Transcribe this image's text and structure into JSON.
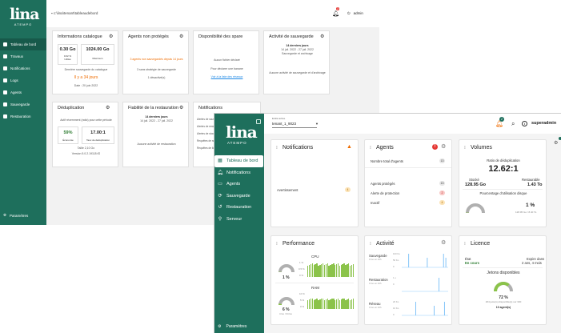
{
  "old_ui": {
    "logo_text": "lina",
    "logo_sub": "ATEMPO",
    "path": "c:\\lina\\tenant\\tableaudebord",
    "bell_badge": "2",
    "user": "admin",
    "nav": [
      {
        "label": "Tableau de bord",
        "active": true
      },
      {
        "label": "Travaux"
      },
      {
        "label": "Notifications"
      },
      {
        "label": "Logs"
      },
      {
        "label": "Agents"
      },
      {
        "label": "Sauvegarde"
      },
      {
        "label": "Restauration"
      }
    ],
    "settings": "Paramètres",
    "cards": {
      "catalog": {
        "title": "Informations catalogue",
        "used_value": "0.30 Go",
        "used_pct": "0.02 %",
        "used_label": "Utilisé",
        "max_value": "1024.00 Go",
        "max_label": "Maximum",
        "last_backup_label": "Dernière sauvegarde du catalogue",
        "last_backup_ago": "Il y a 34 jours",
        "date": "Date : 20 juin 2022"
      },
      "unprotected": {
        "title": "Agents non protégés",
        "warning": "3 agents non sauvegardés depuis 14 jours",
        "line1": "3 sans stratégie de sauvegarde",
        "line2": "1 désactivé(s)"
      },
      "spare": {
        "title": "Disponibilité des spare",
        "line1": "Aucun fichier déclaré",
        "line2": "Pour déclarer une banane",
        "link": "Voir à la liste des réseaux"
      },
      "backup": {
        "title": "Activité de sauvegarde",
        "period": "14 derniers jours",
        "range": "14 juil. 2022 - 27 juil. 2022",
        "sub": "Sauvegarde et archivage",
        "empty": "Aucune activité de sauvegarde et d'archivage"
      },
      "dedup": {
        "title": "Déduplication",
        "desc": "Actif récemment (ratio) pour cette période",
        "saving_value": "59%",
        "saving_label": "Économie",
        "ratio_value": "17.00:1",
        "ratio_label": "Taux de déduplication",
        "total": "Taille 2,10 Go",
        "version": "Version 5.0.2.19118.fG"
      },
      "restore": {
        "title": "Fiabilité de la restauration",
        "period": "14 derniers jours",
        "range": "14 juil. 2022 - 27 juil. 2022",
        "empty": "Aucune activité de restauration"
      },
      "notif": {
        "title": "Notifications",
        "items": [
          "Alertes de sauvegarde",
          "Alertes de restauration",
          "Alertes de stockage",
          "Requêtes de support",
          "Requêtes de licence"
        ]
      }
    }
  },
  "new_ui": {
    "logo_text": "lina",
    "logo_sub": "ATEMPO",
    "tenant_label": "Entité active",
    "tenant_value": "tenant_1_9023",
    "bell_badge": "2",
    "user": "superadmin",
    "nav": [
      {
        "label": "Tableau de bord",
        "icon": "dashboard-icon",
        "active": true
      },
      {
        "label": "Notifications",
        "icon": "bell-icon"
      },
      {
        "label": "Agents",
        "icon": "monitor-icon"
      },
      {
        "label": "Sauvegarde",
        "icon": "backup-icon"
      },
      {
        "label": "Restauration",
        "icon": "restore-icon"
      },
      {
        "label": "Serveur",
        "icon": "server-icon"
      }
    ],
    "settings": "Paramètres",
    "notifications": {
      "title": "Notifications",
      "warning_label": "Avertissement",
      "warning_count": "4"
    },
    "agents": {
      "title": "Agents",
      "alert_badge": "!",
      "total_label": "Nombre total d'agents",
      "total_count": "13",
      "rows": [
        {
          "label": "Agents protégés",
          "count": "13"
        },
        {
          "label": "Alerte de protection",
          "count": "2"
        },
        {
          "label": "Inactif",
          "count": "4"
        }
      ]
    },
    "volumes": {
      "title": "Volumes",
      "ratio_label": "Ratio de déduplication",
      "ratio_value": "12.62:1",
      "stored_label": "Stocké",
      "stored_value": "128.95 Go",
      "restorable_label": "Restaurable",
      "restorable_value": "1.43 To",
      "disk_label": "Pourcentage d'utilisation disque",
      "disk_pct": "1 %",
      "disk_pct_num": 1,
      "disk_detail": "128.95 Go / 8.40 To"
    },
    "performance": {
      "title": "Performance",
      "cpu_label": "CPU",
      "cpu_pct": "1 %",
      "cpu_axis": [
        "1 %",
        "0.5 %",
        "0 %"
      ],
      "cpu_pct_num": 1,
      "ram_label": "RAM",
      "ram_pct": "6 %",
      "ram_pct_num": 6,
      "ram_sub": "4 Go / 64 Go",
      "ram_axis": [
        "10 %",
        "5 %",
        "0 %"
      ]
    },
    "activity": {
      "title": "Activité",
      "rows": [
        {
          "label": "Sauvegarde",
          "sub": "0 Go en 24h",
          "axis": [
            "100 Ko",
            "50 Ko",
            "0"
          ]
        },
        {
          "label": "Restauration",
          "sub": "0 Go en 24h",
          "axis": [
            "1 o",
            "0"
          ]
        },
        {
          "label": "Réseau",
          "sub": "0 Go en 24h",
          "axis": [
            "20 Ko",
            "10 Ko",
            "0"
          ]
        }
      ]
    },
    "license": {
      "title": "Licence",
      "state_label": "État",
      "state_value": "En cours",
      "expiry_label": "Expire dans",
      "expiry_value": "2 ans, 4 mois",
      "tokens_label": "Jetons disponibles",
      "tokens_pct": "72 %",
      "tokens_pct_num": 72,
      "tokens_detail": "264 jeton(s) disponible(s) sur 330",
      "agents_count": "10 agent(s)"
    }
  }
}
